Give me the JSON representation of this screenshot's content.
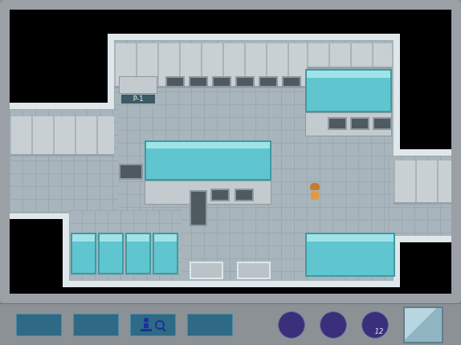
{
  "map": {
    "sign": "P-1",
    "player": {
      "facing": "down"
    }
  },
  "toolbar": {
    "buttons": [
      {
        "kind": "empty"
      },
      {
        "kind": "empty"
      },
      {
        "kind": "search"
      },
      {
        "kind": "empty"
      }
    ]
  },
  "orbs": [
    {
      "badge": ""
    },
    {
      "badge": ""
    },
    {
      "badge": "12"
    }
  ],
  "preview": {
    "kind": "glass"
  }
}
